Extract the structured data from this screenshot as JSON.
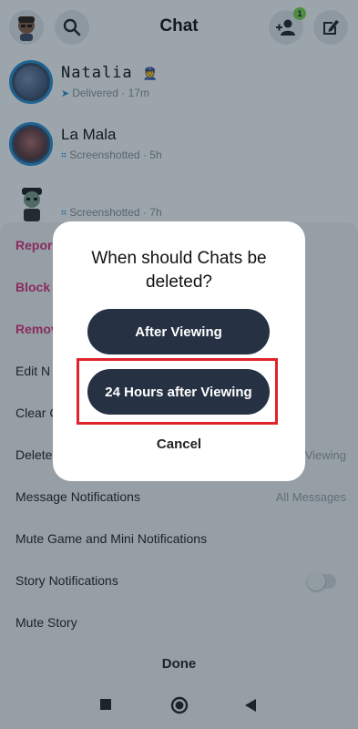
{
  "header": {
    "title": "Chat",
    "add_friend_badge": "1"
  },
  "chats": [
    {
      "name": "Natalia",
      "status_icon": "delivered-arrow",
      "status": "Delivered",
      "time": "17m"
    },
    {
      "name": "La Mala",
      "status_icon": "screenshot",
      "status": "Screenshotted",
      "time": "5h"
    },
    {
      "name": "",
      "status_icon": "screenshot",
      "status": "Screenshotted",
      "time": "7h"
    }
  ],
  "settings": {
    "items": [
      {
        "label": "Report",
        "visible_text": "Repor",
        "style": "danger"
      },
      {
        "label": "Block",
        "visible_text": "Block",
        "style": "danger"
      },
      {
        "label": "Remove",
        "visible_text": "Remov",
        "style": "danger"
      },
      {
        "label": "Edit Name",
        "visible_text": "Edit N",
        "style": "normal"
      },
      {
        "label": "Clear Conversation",
        "visible_text": "Clear C",
        "style": "normal"
      },
      {
        "label": "Delete Chats",
        "visible_text": "Delete",
        "style": "normal",
        "value": "Viewing"
      },
      {
        "label": "Message Notifications",
        "visible_text": "Message Notifications",
        "style": "normal",
        "value": "All Messages"
      },
      {
        "label": "Mute Game and Mini Notifications",
        "visible_text": "Mute Game and Mini Notifications",
        "style": "normal"
      },
      {
        "label": "Story Notifications",
        "visible_text": "Story Notifications",
        "style": "normal",
        "toggle": false
      },
      {
        "label": "Mute Story",
        "visible_text": "Mute Story",
        "style": "normal"
      }
    ],
    "done_label": "Done"
  },
  "modal": {
    "title": "When should Chats be deleted?",
    "options": [
      {
        "label": "After Viewing"
      },
      {
        "label": "24 Hours after Viewing",
        "highlighted": true
      }
    ],
    "cancel_label": "Cancel"
  },
  "colors": {
    "accent": "#263244",
    "danger": "#e02d7c",
    "highlight": "#e0222a",
    "ring": "#2a8fd6"
  },
  "navbar": {
    "icons": [
      "square-icon",
      "circle-icon",
      "triangle-back-icon"
    ]
  }
}
